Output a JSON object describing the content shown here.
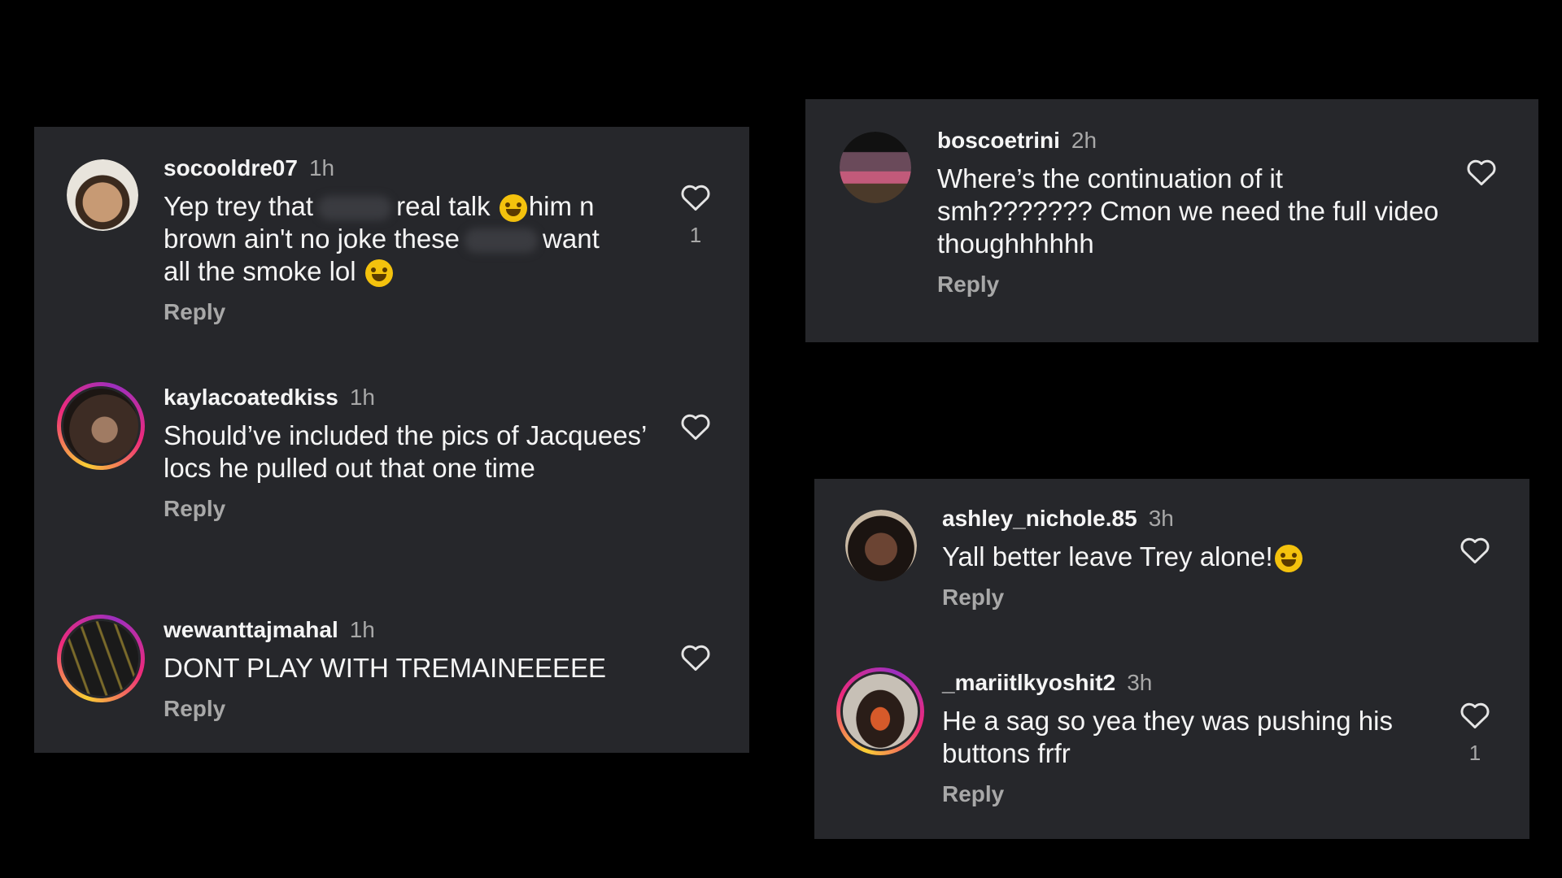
{
  "left_panel": {
    "comments": [
      {
        "username": "socooldre07",
        "time": "1h",
        "text_a": "Yep trey that",
        "text_b": "real talk",
        "text_c": "him n",
        "text_d": "brown ain't no joke these",
        "text_e": "want",
        "text_f": "all the smoke lol",
        "reply": "Reply",
        "likes": "1",
        "avatar_icon": "avatar-photo",
        "like_icon": "heart-outline-icon"
      },
      {
        "username": "kaylacoatedkiss",
        "time": "1h",
        "text": "Should’ve included the pics of Jacquees’ locs he pulled out that one time",
        "reply": "Reply",
        "avatar_icon": "avatar-photo-story-ring",
        "like_icon": "heart-outline-icon"
      },
      {
        "username": "wewanttajmahal",
        "time": "1h",
        "text": "DONT PLAY WITH TREMAINEEEEE",
        "reply": "Reply",
        "avatar_icon": "avatar-photo-story-ring",
        "like_icon": "heart-outline-icon"
      }
    ]
  },
  "top_right_panel": {
    "comments": [
      {
        "username": "boscoetrini",
        "time": "2h",
        "text": "Where’s the continuation of it smh??????? Cmon we need the full video thoughhhhhh",
        "reply": "Reply",
        "like_icon": "heart-outline-icon"
      }
    ]
  },
  "bottom_right_panel": {
    "comments": [
      {
        "username": "ashley_nichole.85",
        "time": "3h",
        "text": "Yall better leave Trey alone!",
        "reply": "Reply",
        "like_icon": "heart-outline-icon"
      },
      {
        "username": "_mariitlkyoshit2",
        "time": "3h",
        "text": "He a sag so yea they was pushing his buttons frfr",
        "reply": "Reply",
        "likes": "1",
        "like_icon": "heart-outline-icon"
      }
    ]
  },
  "colors": {
    "background": "#000000",
    "panel": "#26272b",
    "primary_text": "#f5f5f5",
    "secondary_text": "#a8a8a8"
  }
}
